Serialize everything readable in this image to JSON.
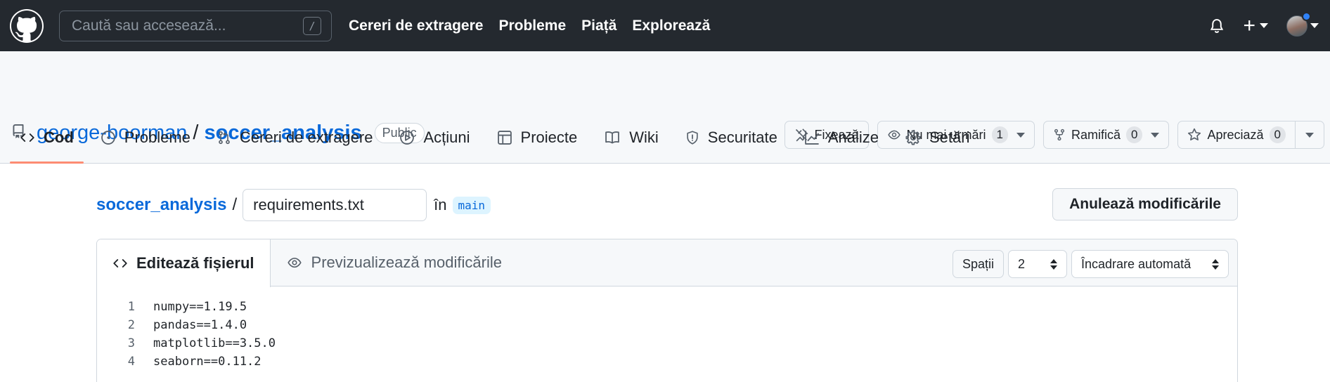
{
  "topbar": {
    "search_placeholder": "Caută sau accesează...",
    "search_shortcut": "/",
    "nav": [
      "Cereri de extragere",
      "Probleme",
      "Piață",
      "Explorează"
    ],
    "plus_label": "+"
  },
  "repo": {
    "owner": "george-boorman",
    "separator": "/",
    "name": "soccer_analysis",
    "visibility": "Public",
    "actions": {
      "pin_label": "Fixează",
      "unwatch_label": "Nu mai urmări",
      "watch_count": "1",
      "fork_label": "Ramifică",
      "fork_count": "0",
      "star_label": "Apreciază",
      "star_count": "0"
    }
  },
  "tabs": [
    {
      "label": "Cod",
      "active": true
    },
    {
      "label": "Probleme"
    },
    {
      "label": "Cereri de extragere"
    },
    {
      "label": "Acțiuni"
    },
    {
      "label": "Proiecte"
    },
    {
      "label": "Wiki"
    },
    {
      "label": "Securitate"
    },
    {
      "label": "Analize"
    },
    {
      "label": "Setări"
    }
  ],
  "editor": {
    "breadcrumb_repo": "soccer_analysis",
    "breadcrumb_sep": "/",
    "filename": "requirements.txt",
    "in_label": "în",
    "branch": "main",
    "cancel_label": "Anulează modificările",
    "edit_tab": "Editează fișierul",
    "preview_tab": "Previzualizează modificările",
    "indent_mode": "Spații",
    "indent_size": "2",
    "wrap_mode": "Încadrare automată",
    "lines": [
      {
        "n": "1",
        "text": "numpy==1.19.5"
      },
      {
        "n": "2",
        "text": "pandas==1.4.0"
      },
      {
        "n": "3",
        "text": "matplotlib==3.5.0"
      },
      {
        "n": "4",
        "text": "seaborn==0.11.2"
      }
    ]
  },
  "colors": {
    "header_bg": "#24292f",
    "link": "#0969da",
    "active_tab_underline": "#fd8c73",
    "notification_dot": "#2f81f7"
  }
}
